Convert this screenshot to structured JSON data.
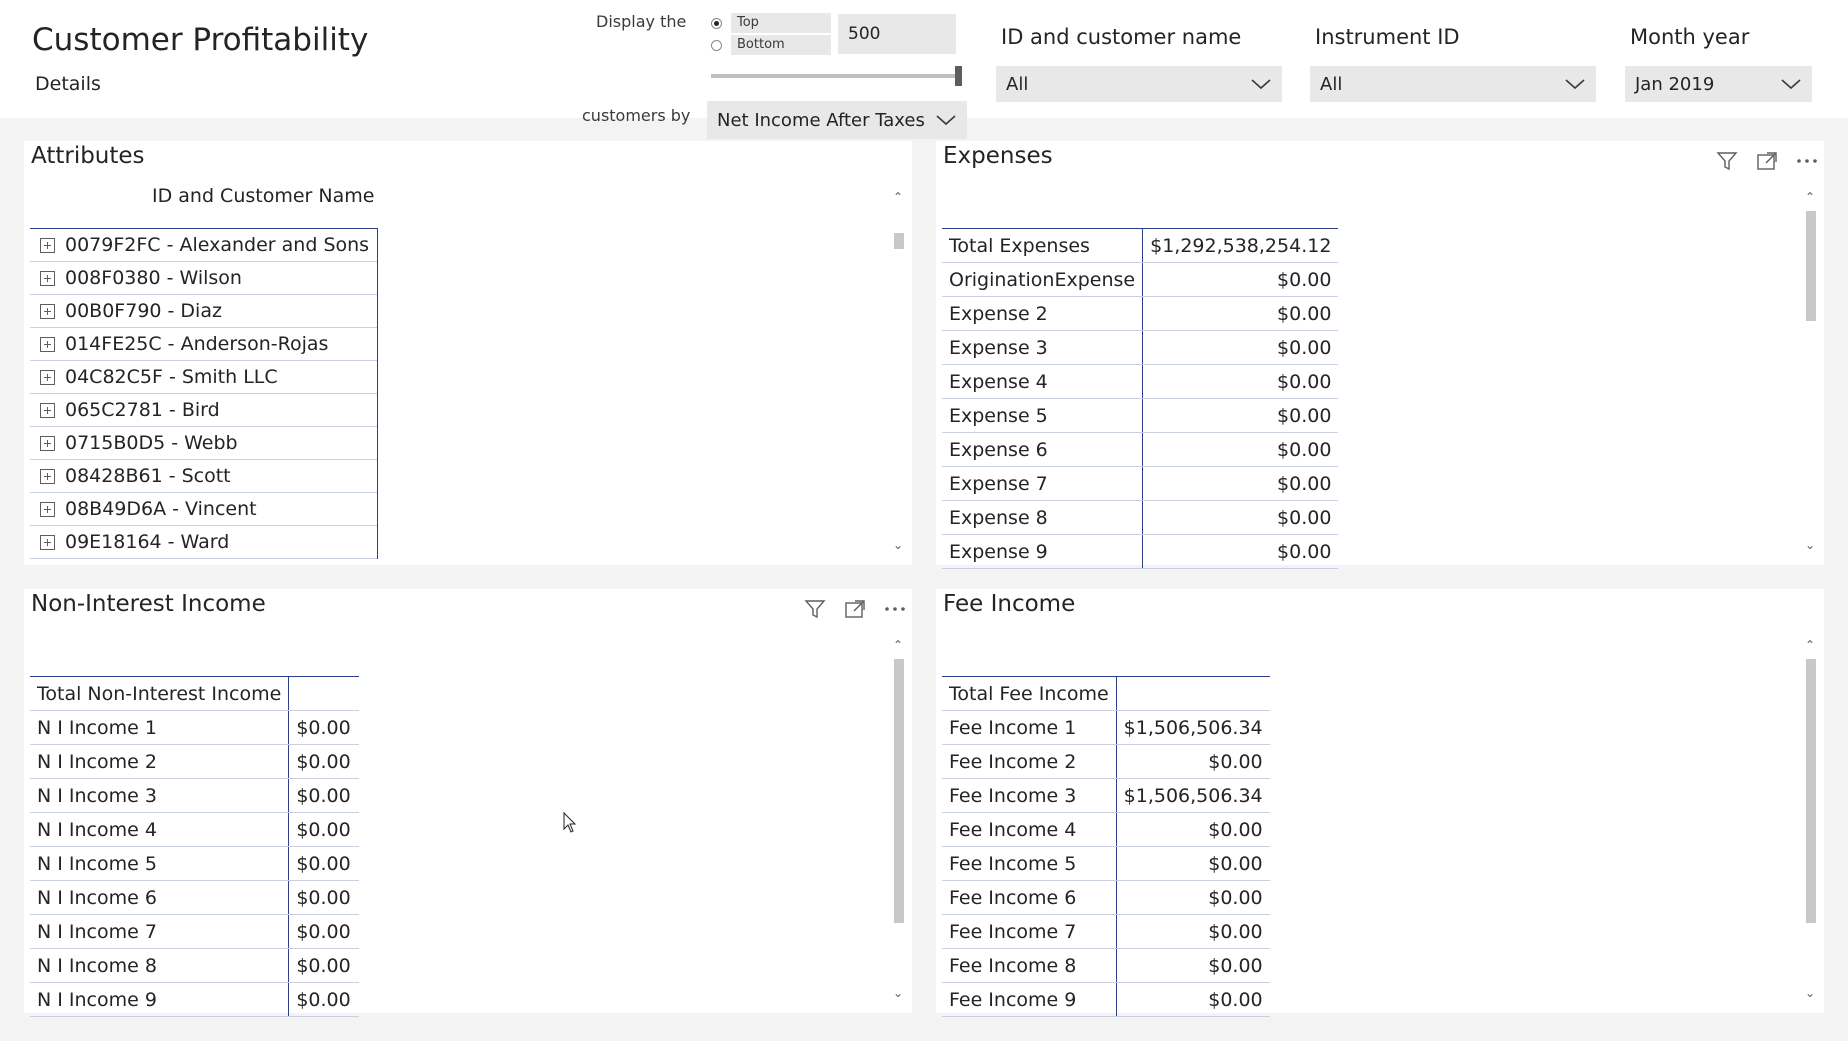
{
  "header": {
    "title": "Customer Profitability",
    "subtitle": "Details",
    "display_label": "Display the",
    "customers_by_label": "customers by",
    "radio_top": "Top",
    "radio_bottom": "Bottom",
    "top_selected": true,
    "count_value": "500",
    "measure_value": "Net Income After Taxes"
  },
  "slicers": [
    {
      "label": "ID and customer name",
      "value": "All"
    },
    {
      "label": "Instrument ID",
      "value": "All"
    },
    {
      "label": "Month year",
      "value": "Jan 2019"
    }
  ],
  "attributes": {
    "title": "Attributes",
    "column_header": "ID and Customer Name",
    "rows": [
      "0079F2FC - Alexander and Sons",
      "008F0380 - Wilson",
      "00B0F790 - Diaz",
      "014FE25C - Anderson-Rojas",
      "04C82C5F - Smith LLC",
      "065C2781 - Bird",
      "0715B0D5 - Webb",
      "08428B61 - Scott",
      "08B49D6A - Vincent",
      "09E18164 - Ward"
    ]
  },
  "expenses": {
    "title": "Expenses",
    "rows": [
      [
        "Total Expenses",
        "$1,292,538,254.12"
      ],
      [
        "OriginationExpense",
        "$0.00"
      ],
      [
        "Expense 2",
        "$0.00"
      ],
      [
        "Expense 3",
        "$0.00"
      ],
      [
        "Expense 4",
        "$0.00"
      ],
      [
        "Expense 5",
        "$0.00"
      ],
      [
        "Expense 6",
        "$0.00"
      ],
      [
        "Expense 7",
        "$0.00"
      ],
      [
        "Expense 8",
        "$0.00"
      ],
      [
        "Expense 9",
        "$0.00"
      ]
    ]
  },
  "non_interest": {
    "title": "Non-Interest Income",
    "rows": [
      [
        "Total Non-Interest Income",
        ""
      ],
      [
        "N I Income 1",
        "$0.00"
      ],
      [
        "N I Income 2",
        "$0.00"
      ],
      [
        "N I Income 3",
        "$0.00"
      ],
      [
        "N I Income 4",
        "$0.00"
      ],
      [
        "N I Income 5",
        "$0.00"
      ],
      [
        "N I Income 6",
        "$0.00"
      ],
      [
        "N I Income 7",
        "$0.00"
      ],
      [
        "N I Income 8",
        "$0.00"
      ],
      [
        "N I Income 9",
        "$0.00"
      ]
    ]
  },
  "fee_income": {
    "title": "Fee Income",
    "rows": [
      [
        "Total Fee Income",
        ""
      ],
      [
        "Fee Income 1",
        "$1,506,506.34"
      ],
      [
        "Fee Income 2",
        "$0.00"
      ],
      [
        "Fee Income 3",
        "$1,506,506.34"
      ],
      [
        "Fee Income 4",
        "$0.00"
      ],
      [
        "Fee Income 5",
        "$0.00"
      ],
      [
        "Fee Income 6",
        "$0.00"
      ],
      [
        "Fee Income 7",
        "$0.00"
      ],
      [
        "Fee Income 8",
        "$0.00"
      ],
      [
        "Fee Income 9",
        "$0.00"
      ]
    ]
  },
  "colors": {
    "table_border": "#2e3e8b",
    "row_divider": "#c7cfe3",
    "slicer_bg": "#e8e8e8"
  }
}
